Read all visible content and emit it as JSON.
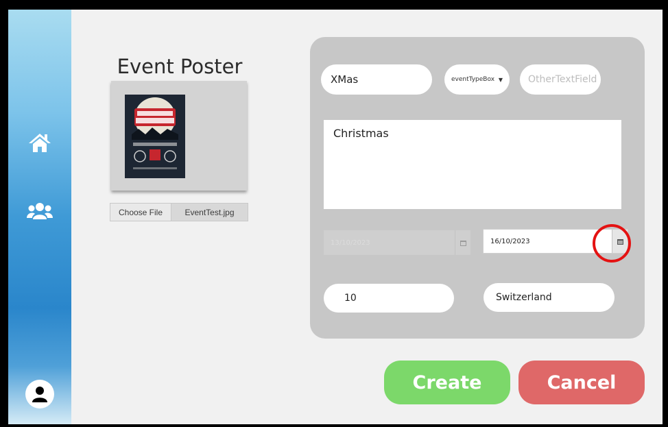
{
  "nav": {
    "icons": [
      "home-icon",
      "users-icon",
      "account-icon"
    ]
  },
  "poster": {
    "title": "Event Poster",
    "choose_file_label": "Choose File",
    "file_name": "EventTest.jpg"
  },
  "form": {
    "title_value": "XMas",
    "event_type_label": "eventTypeBox",
    "other_placeholder": "OtherTextField",
    "description_value": "Christmas",
    "start_date": "13/10/2023",
    "end_date": "16/10/2023",
    "capacity_value": "10",
    "location_value": "Switzerland"
  },
  "actions": {
    "create_label": "Create",
    "cancel_label": "Cancel"
  },
  "colors": {
    "create": "#7cd86a",
    "cancel": "#df6868",
    "highlight": "#e41212"
  }
}
